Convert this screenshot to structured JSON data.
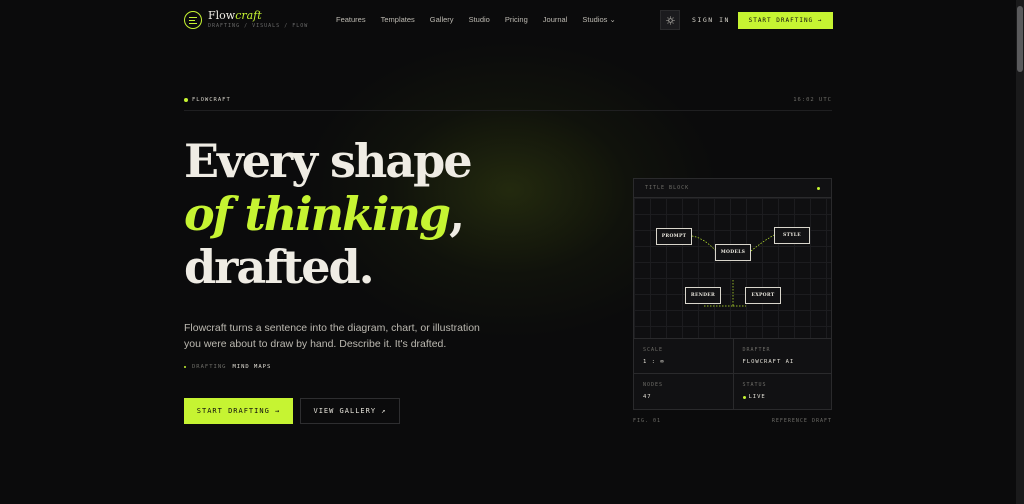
{
  "brand": {
    "name_plain": "Flow",
    "name_accent": "craft",
    "tagline": "DRAFTING / VISUALS / FLOW"
  },
  "nav": {
    "items": [
      "Features",
      "Templates",
      "Gallery",
      "Studio",
      "Pricing",
      "Journal",
      "Studios"
    ],
    "signin": "SIGN IN",
    "cta": "START DRAFTING →"
  },
  "hero": {
    "eyebrow": "FLOWCRAFT",
    "time": "16:02 UTC",
    "line1": "Every shape",
    "line2": "of thinking",
    "comma": ",",
    "line3": "drafted.",
    "lede": "Flowcraft turns a sentence into the diagram, chart, or illustration you were about to draw by hand. Describe it. It's drafted.",
    "drafting_key": "DRAFTING",
    "drafting_value": "MIND MAPS",
    "primary_button": "START DRAFTING →",
    "secondary_button": "VIEW GALLERY ↗"
  },
  "card": {
    "title": "TITLE BLOCK",
    "nodes": {
      "prompt": "PROMPT",
      "models": "MODELS",
      "style": "STYLE",
      "render": "RENDER",
      "export": "EXPORT"
    },
    "scale_label": "SCALE",
    "scale_value": "1 : ∞",
    "drafter_label": "DRAFTER",
    "drafter_value": "FLOWCRAFT AI",
    "nodes_label": "NODES",
    "nodes_value": "47",
    "status_label": "STATUS",
    "status_value": "LIVE",
    "fig_left": "FIG. 01",
    "fig_right": "REFERENCE DRAFT"
  },
  "colors": {
    "accent": "#c6f432",
    "background": "#0b0b0c"
  },
  "icons": {
    "logo": "flowcraft-logo-icon",
    "theme": "sun-icon",
    "chevron": "chevron-down-icon"
  }
}
